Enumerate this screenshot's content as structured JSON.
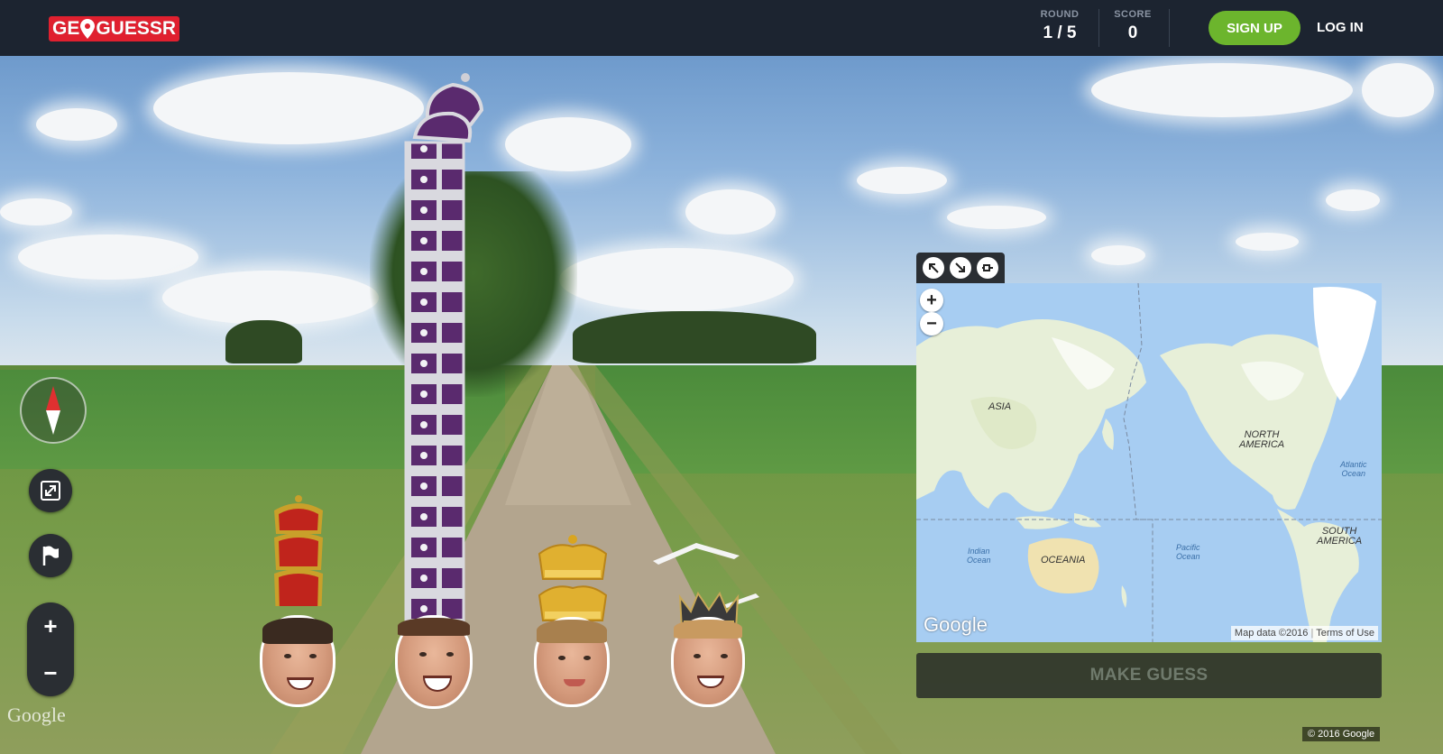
{
  "header": {
    "logo_text_left": "GE",
    "logo_text_right": "GUESSR",
    "round_label": "ROUND",
    "round_value": "1 / 5",
    "score_label": "SCORE",
    "score_value": "0",
    "signup_label": "SIGN UP",
    "login_label": "LOG IN"
  },
  "map": {
    "labels": {
      "asia": "ASIA",
      "north_america_1": "NORTH",
      "north_america_2": "AMERICA",
      "south_america_1": "SOUTH",
      "south_america_2": "AMERICA",
      "oceania": "OCEANIA",
      "indian_1": "Indian",
      "indian_2": "Ocean",
      "pacific_1": "Pacific",
      "pacific_2": "Ocean",
      "atlantic_1": "Atlantic",
      "atlantic_2": "Ocean"
    },
    "google": "Google",
    "map_data": "Map data ©2016",
    "terms": "Terms of Use",
    "zoom_in": "+",
    "zoom_out": "−"
  },
  "guess_button": "MAKE GUESS",
  "streetview": {
    "watermark": "Google",
    "copyright": "© 2016 Google",
    "zoom_in": "+",
    "zoom_out": "−"
  },
  "colors": {
    "brand_red": "#e0202f",
    "signup_green": "#6cb52d",
    "topbar": "#1c2430"
  }
}
